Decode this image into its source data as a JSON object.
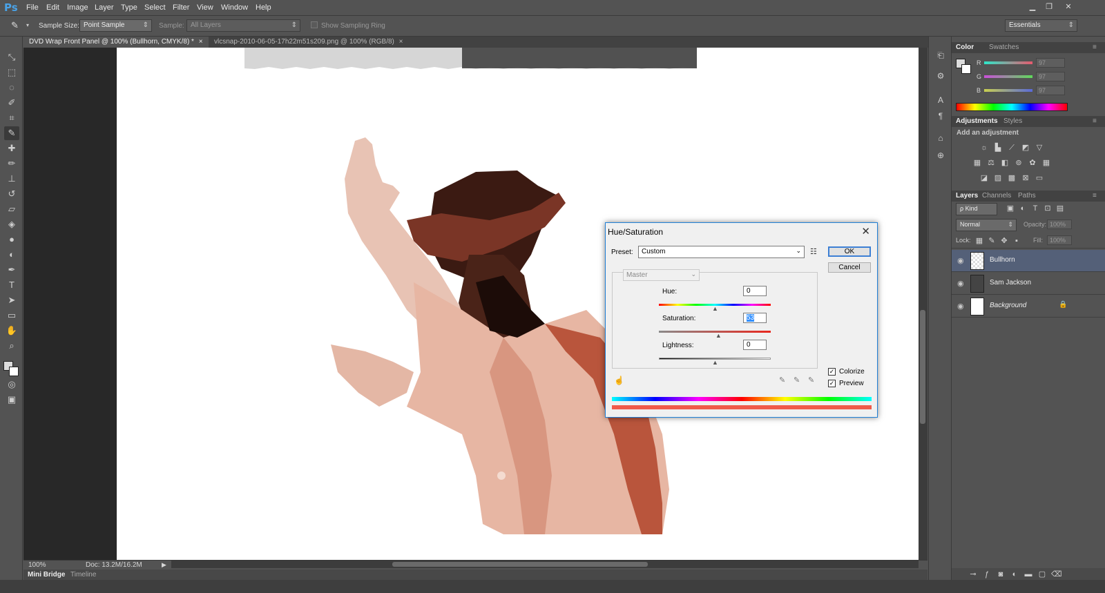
{
  "app": {
    "logo": "Ps"
  },
  "menu": [
    "File",
    "Edit",
    "Image",
    "Layer",
    "Type",
    "Select",
    "Filter",
    "View",
    "Window",
    "Help"
  ],
  "window_controls": {
    "minimize": "▁",
    "restore": "❐",
    "close": "✕"
  },
  "options_bar": {
    "sample_size_label": "Sample Size:",
    "sample_size_value": "Point Sample",
    "sample_label": "Sample:",
    "sample_value": "All Layers",
    "show_sampling_ring": "Show Sampling Ring",
    "workspace": "Essentials"
  },
  "document_tabs": [
    {
      "label": "DVD Wrap Front Panel @ 100% (Bullhorn, CMYK/8) *",
      "close": "×"
    },
    {
      "label": "vlcsnap-2010-06-05-17h22m51s209.png @ 100% (RGB/8)",
      "close": "×"
    }
  ],
  "status": {
    "zoom": "100%",
    "doc": "Doc: 13.2M/16.2M"
  },
  "bottom_tabs": [
    "Mini Bridge",
    "Timeline"
  ],
  "color_panel": {
    "tabs": [
      "Color",
      "Swatches"
    ],
    "channels": [
      {
        "name": "R",
        "value": "97"
      },
      {
        "name": "G",
        "value": "97"
      },
      {
        "name": "B",
        "value": "97"
      }
    ]
  },
  "adjustments_panel": {
    "tabs": [
      "Adjustments",
      "Styles"
    ],
    "subtitle": "Add an adjustment"
  },
  "layers_panel": {
    "tabs": [
      "Layers",
      "Channels",
      "Paths"
    ],
    "filter_label": "ρ Kind",
    "blend_mode": "Normal",
    "opacity_label": "Opacity:",
    "opacity_value": "100%",
    "lock_label": "Lock:",
    "fill_label": "Fill:",
    "fill_value": "100%",
    "layers": [
      {
        "name": "Bullhorn",
        "selected": true
      },
      {
        "name": "Sam Jackson",
        "selected": false
      },
      {
        "name": "Background",
        "selected": false,
        "locked": true
      }
    ]
  },
  "dialog": {
    "title": "Hue/Saturation",
    "close": "✕",
    "preset_label": "Preset:",
    "preset_value": "Custom",
    "ok_label": "OK",
    "cancel_label": "Cancel",
    "channel_value": "Master",
    "hue_label": "Hue:",
    "hue_value": "0",
    "saturation_label": "Saturation:",
    "saturation_value": "53",
    "lightness_label": "Lightness:",
    "lightness_value": "0",
    "colorize_label": "Colorize",
    "colorize_checked": true,
    "preview_label": "Preview",
    "preview_checked": true,
    "hue_range": [
      -180,
      180
    ],
    "saturation_range": [
      0,
      100
    ],
    "lightness_range": [
      -100,
      100
    ]
  }
}
